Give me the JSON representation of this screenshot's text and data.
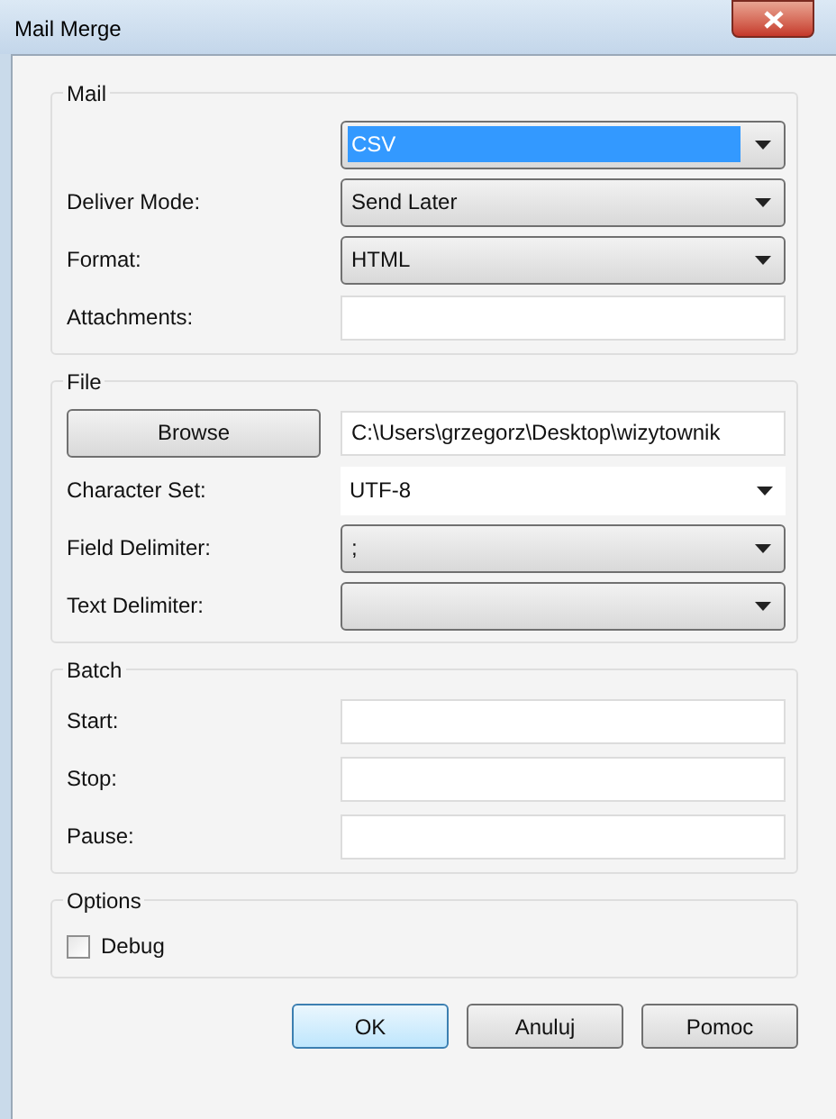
{
  "window": {
    "title": "Mail Merge"
  },
  "groups": [
    {
      "title": "Mail",
      "rows": [
        {
          "kind": "dropdown",
          "value": "CSV",
          "focused": true
        },
        {
          "label": "Deliver Mode:",
          "kind": "dropdown",
          "value": "Send Later",
          "focused": false
        },
        {
          "label": "Format:",
          "kind": "dropdown",
          "value": "HTML",
          "focused": false
        },
        {
          "label": "Attachments:",
          "kind": "text"
        }
      ]
    },
    {
      "title": "File",
      "rows": [
        {
          "button": "Browse",
          "kind": "text",
          "value": "C:\\Users\\grzegorz\\Desktop\\wizytownik"
        },
        {
          "label": "Character Set:",
          "kind": "combo",
          "value": "UTF-8"
        },
        {
          "label": "Field Delimiter:",
          "kind": "dropdown",
          "value": ";",
          "focused": false
        },
        {
          "label": "Text Delimiter:",
          "kind": "dropdown",
          "focused": false
        }
      ]
    },
    {
      "title": "Batch",
      "rows": [
        {
          "label": "Start:",
          "kind": "text"
        },
        {
          "label": "Stop:",
          "kind": "text"
        },
        {
          "label": "Pause:",
          "kind": "text"
        }
      ]
    },
    {
      "title": "Options",
      "rows": [
        {
          "label": "Debug",
          "kind": "checkbox",
          "checked": false
        }
      ]
    }
  ],
  "buttons": [
    {
      "label": "OK",
      "default": true
    },
    {
      "label": "Anuluj",
      "default": false
    },
    {
      "label": "Pomoc",
      "default": false
    }
  ]
}
